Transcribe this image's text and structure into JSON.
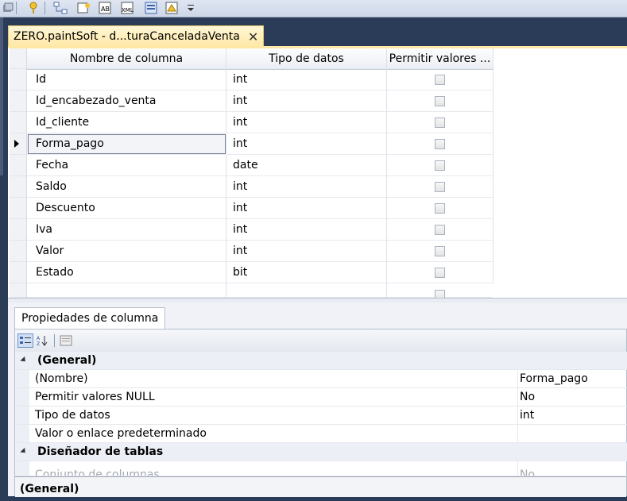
{
  "tab": {
    "title": "ZERO.paintSoft - d...turaCanceladaVenta",
    "close": "✕"
  },
  "grid": {
    "headers": [
      "Nombre de columna",
      "Tipo de datos",
      "Permitir valores ..."
    ],
    "rows": [
      {
        "name": "Id",
        "type": "int"
      },
      {
        "name": "Id_encabezado_venta",
        "type": "int"
      },
      {
        "name": "Id_cliente",
        "type": "int"
      },
      {
        "name": "Forma_pago",
        "type": "int"
      },
      {
        "name": "Fecha",
        "type": "date"
      },
      {
        "name": "Saldo",
        "type": "int"
      },
      {
        "name": "Descuento",
        "type": "int"
      },
      {
        "name": "Iva",
        "type": "int"
      },
      {
        "name": "Valor",
        "type": "int"
      },
      {
        "name": "Estado",
        "type": "bit"
      }
    ]
  },
  "properties": {
    "tab_label": "Propiedades de columna",
    "general_category": "(General)",
    "items": [
      {
        "name": "(Nombre)",
        "value": "Forma_pago"
      },
      {
        "name": "Permitir valores NULL",
        "value": "No"
      },
      {
        "name": "Tipo de datos",
        "value": "int"
      },
      {
        "name": "Valor o enlace predeterminado",
        "value": ""
      }
    ],
    "designer_category": "Diseñador de tablas",
    "partial_item": {
      "name": "Conjunto de columnas",
      "value": "No"
    },
    "description_title": "(General)"
  },
  "colors": {
    "background": "#2b3c59",
    "tab_active": "#ffe8a6"
  }
}
